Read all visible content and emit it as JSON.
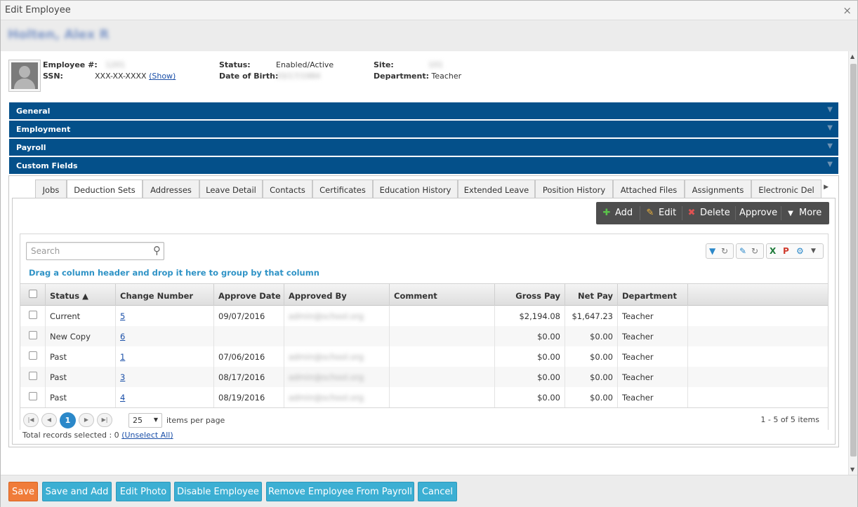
{
  "window": {
    "title": "Edit Employee",
    "close_glyph": "×"
  },
  "employee_header": {
    "name": "Holten, Alex R"
  },
  "info": {
    "employee_no_label": "Employee #:",
    "employee_no_value": "1201",
    "ssn_label": "SSN:",
    "ssn_value": "XXX-XX-XXXX",
    "show_link": "(Show)",
    "status_label": "Status:",
    "status_value": "Enabled/Active",
    "dob_label": "Date of Birth:",
    "dob_value": "03/17/1984",
    "site_label": "Site:",
    "site_value": "101",
    "department_label": "Department:",
    "department_value": "Teacher"
  },
  "accordion": [
    "General",
    "Employment",
    "Payroll",
    "Custom Fields"
  ],
  "tabs": [
    "Jobs",
    "Deduction Sets",
    "Addresses",
    "Leave Detail",
    "Contacts",
    "Certificates",
    "Education History",
    "Extended Leave",
    "Position History",
    "Attached Files",
    "Assignments",
    "Electronic Del"
  ],
  "active_tab": "Deduction Sets",
  "toolbar": {
    "add": "Add",
    "edit": "Edit",
    "delete": "Delete",
    "approve": "Approve",
    "more": "More"
  },
  "grid": {
    "search_placeholder": "Search",
    "group_hint": "Drag a column header and drop it here to group by that column",
    "columns": [
      "Status ▲",
      "Change Number",
      "Approve Date",
      "Approved By",
      "Comment",
      "Gross Pay",
      "Net Pay",
      "Department"
    ],
    "rows": [
      {
        "status": "Current",
        "change": "5",
        "approve_date": "09/07/2016",
        "approved_by": "admin@school.org",
        "comment": "",
        "gross": "$2,194.08",
        "net": "$1,647.23",
        "dept": "Teacher"
      },
      {
        "status": "New Copy",
        "change": "6",
        "approve_date": "",
        "approved_by": "",
        "comment": "",
        "gross": "$0.00",
        "net": "$0.00",
        "dept": "Teacher"
      },
      {
        "status": "Past",
        "change": "1",
        "approve_date": "07/06/2016",
        "approved_by": "admin@school.org",
        "comment": "",
        "gross": "$0.00",
        "net": "$0.00",
        "dept": "Teacher"
      },
      {
        "status": "Past",
        "change": "3",
        "approve_date": "08/17/2016",
        "approved_by": "admin@school.org",
        "comment": "",
        "gross": "$0.00",
        "net": "$0.00",
        "dept": "Teacher"
      },
      {
        "status": "Past",
        "change": "4",
        "approve_date": "08/19/2016",
        "approved_by": "admin@school.org",
        "comment": "",
        "gross": "$0.00",
        "net": "$0.00",
        "dept": "Teacher"
      }
    ],
    "pager": {
      "current_page": "1",
      "page_size": "25",
      "items_per_page": "items per page",
      "info": "1 - 5 of 5 items"
    }
  },
  "selection": {
    "text": "Total records selected : 0",
    "unselect": "(Unselect All)"
  },
  "footer": {
    "save": "Save",
    "save_add": "Save and Add",
    "edit_photo": "Edit Photo",
    "disable": "Disable Employee",
    "remove": "Remove Employee From Payroll",
    "cancel": "Cancel"
  },
  "colors": {
    "accordion": "#04508a",
    "footer_button": "#3cafd3",
    "save_button": "#f07c3a",
    "toolbar": "#4e4e4e",
    "link": "#2f93c6"
  }
}
